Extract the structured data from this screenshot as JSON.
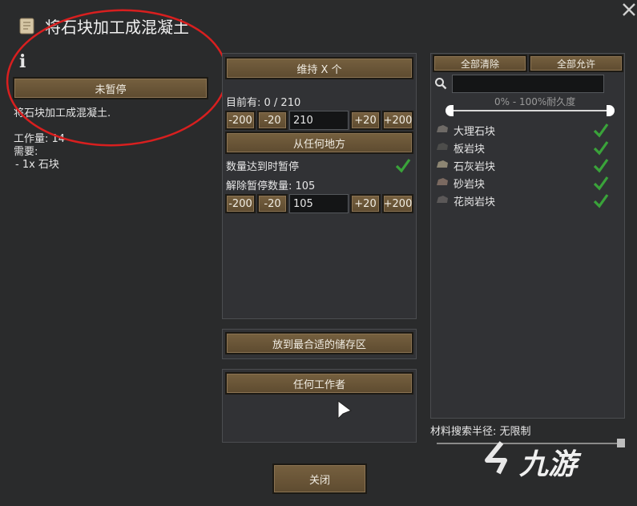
{
  "header": {
    "title": "将石块加工成混凝土",
    "info_glyph": "i"
  },
  "left": {
    "suspend_button": "未暂停",
    "description": "将石块加工成混凝土.",
    "work_amount": "工作量: 14",
    "requires_label": "需要:",
    "requires_item": "- 1x 石块"
  },
  "middle": {
    "repeat_mode_button": "维持 X 个",
    "current_count": "目前有: 0 / 210",
    "target_steps": [
      "-200",
      "-20",
      "+20",
      "+200"
    ],
    "target_value": "210",
    "count_from_button": "从任何地方",
    "pause_when_satisfied": "数量达到时暂停",
    "unpause_label": "解除暂停数量: 105",
    "unpause_steps": [
      "-200",
      "-20",
      "+20",
      "+200"
    ],
    "unpause_value": "105",
    "store_mode_button": "放到最合适的储存区",
    "worker_button": "任何工作者"
  },
  "right": {
    "clear_all": "全部清除",
    "allow_all": "全部允许",
    "search_value": "",
    "hp_range": "0% - 100%耐久度",
    "materials": [
      {
        "label": "大理石块",
        "color": "#6e6a66"
      },
      {
        "label": "板岩块",
        "color": "#4d4d4b"
      },
      {
        "label": "石灰岩块",
        "color": "#8d8673"
      },
      {
        "label": "砂岩块",
        "color": "#7a6960"
      },
      {
        "label": "花岗岩块",
        "color": "#5b5858"
      }
    ],
    "search_radius": "材料搜索半径: 无限制"
  },
  "footer": {
    "close_button": "关闭",
    "watermark": "九游"
  },
  "colors": {
    "annotation_ring": "#d81f1f",
    "check": "#3aa33a"
  }
}
